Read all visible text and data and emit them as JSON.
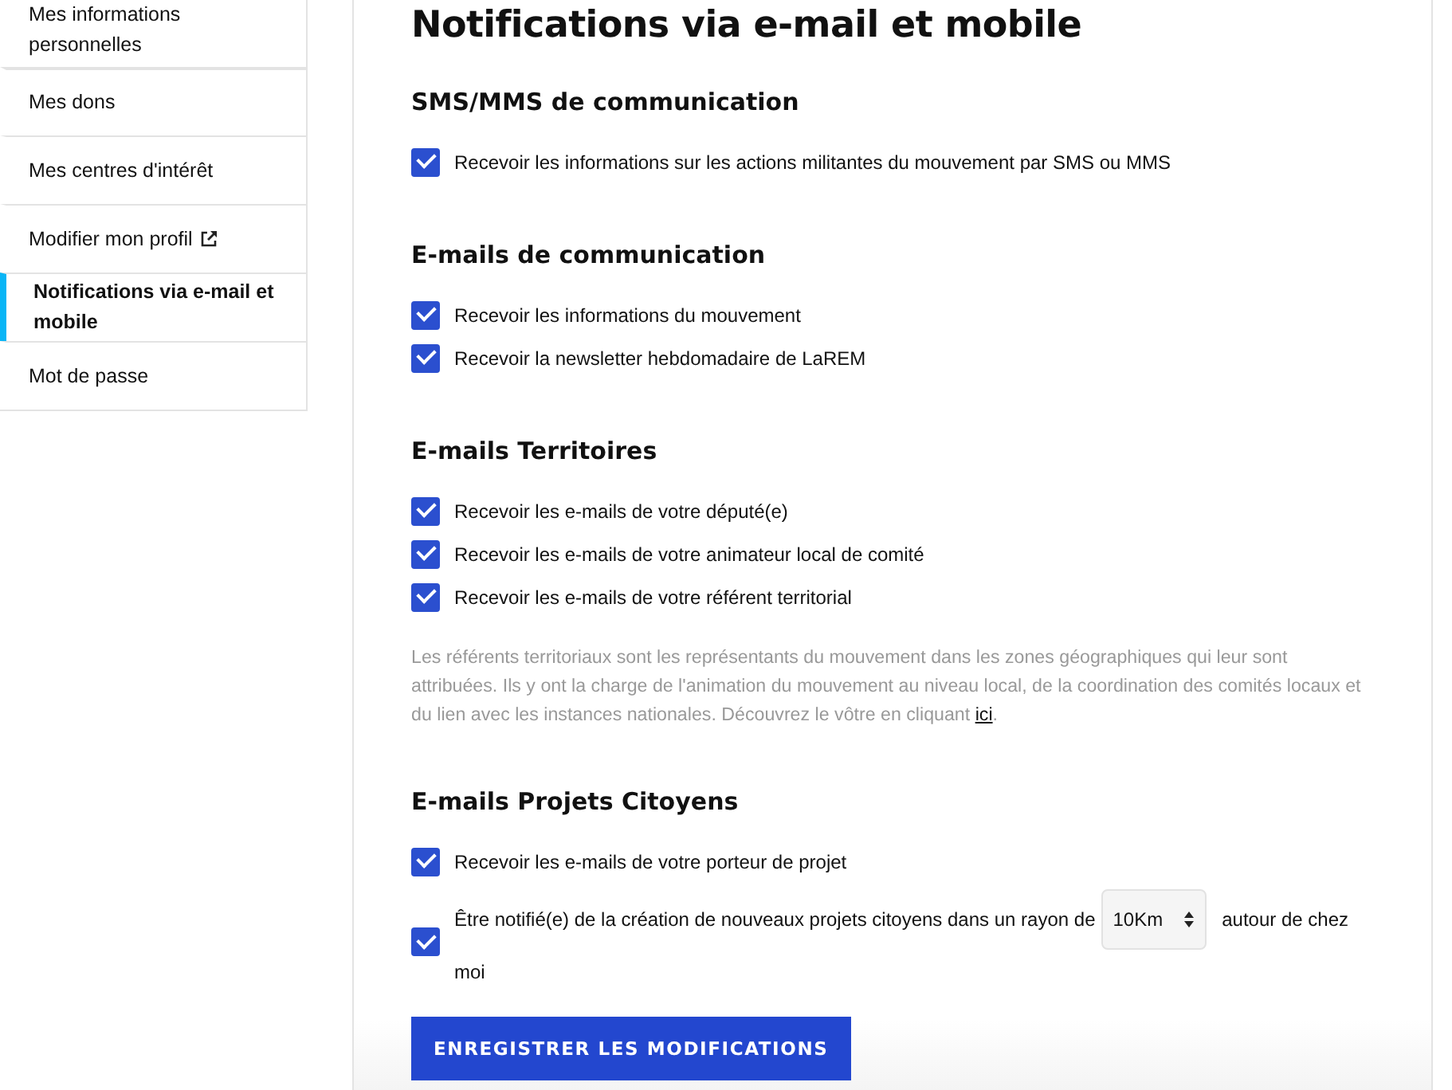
{
  "sidebar": {
    "items": [
      {
        "label": "Mes informations personnelles",
        "selected": false,
        "external": false
      },
      {
        "label": "Mes dons",
        "selected": false,
        "external": false
      },
      {
        "label": "Mes centres d'intérêt",
        "selected": false,
        "external": false
      },
      {
        "label": "Modifier mon profil",
        "selected": false,
        "external": true
      },
      {
        "label": "Notifications via e-mail et mobile",
        "selected": true,
        "external": false
      },
      {
        "label": "Mot de passe",
        "selected": false,
        "external": false
      }
    ]
  },
  "main": {
    "title": "Notifications via e-mail et mobile",
    "sections": [
      {
        "heading": "SMS/MMS de communication",
        "options": [
          {
            "kind": "checkbox",
            "label": "Recevoir les informations sur les actions militantes du mouvement par SMS ou MMS",
            "checked": true
          }
        ]
      },
      {
        "heading": "E-mails de communication",
        "options": [
          {
            "kind": "checkbox",
            "label": "Recevoir les informations du mouvement",
            "checked": true
          },
          {
            "kind": "checkbox",
            "label": "Recevoir la newsletter hebdomadaire de LaREM",
            "checked": true
          }
        ]
      },
      {
        "heading": "E-mails Territoires",
        "options": [
          {
            "kind": "checkbox",
            "label": "Recevoir les e-mails de votre député(e)",
            "checked": true
          },
          {
            "kind": "checkbox",
            "label": "Recevoir les e-mails de votre animateur local de comité",
            "checked": true
          },
          {
            "kind": "checkbox",
            "label": "Recevoir les e-mails de votre référent territorial",
            "checked": true
          }
        ],
        "note": {
          "text": "Les référents territoriaux sont les représentants du mouvement dans les zones géographiques qui leur sont attribuées. Ils y ont la charge de l'animation du mouvement au niveau local, de la coordination des comités locaux et du lien avec les instances nationales. Découvrez le vôtre en cliquant ",
          "link": "ici",
          "after": "."
        }
      },
      {
        "heading": "E-mails Projets Citoyens",
        "options": [
          {
            "kind": "checkbox",
            "label": "Recevoir les e-mails de votre porteur de projet",
            "checked": true
          },
          {
            "kind": "checkbox_select",
            "label": "Être notifié(e) de la création de nouveaux projets citoyens dans un rayon de",
            "select": "10Km",
            "after": "autour de chez",
            "after_2": "moi",
            "checked": true
          }
        ]
      }
    ],
    "save_button": "ENREGISTRER LES MODIFICATIONS"
  }
}
